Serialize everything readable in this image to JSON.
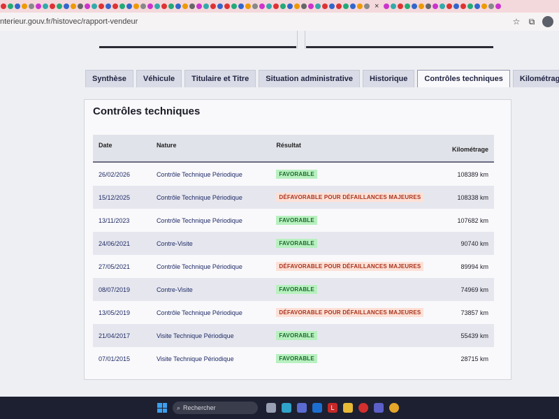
{
  "browser": {
    "url": "nterieur.gouv.fr/histovec/rapport-vendeur",
    "tab_close": "×"
  },
  "tabs": [
    {
      "label": "Synthèse",
      "active": false
    },
    {
      "label": "Véhicule",
      "active": false
    },
    {
      "label": "Titulaire et Titre",
      "active": false
    },
    {
      "label": "Situation administrative",
      "active": false
    },
    {
      "label": "Historique",
      "active": false
    },
    {
      "label": "Contrôles techniques",
      "active": true
    },
    {
      "label": "Kilométrage",
      "active": false
    }
  ],
  "section": {
    "title": "Contrôles techniques",
    "columns": [
      "Date",
      "Nature",
      "Résultat",
      "Kilométrage"
    ],
    "rows": [
      {
        "date": "26/02/2026",
        "nature": "Contrôle Technique Périodique",
        "result": "FAVORABLE",
        "status": "fav",
        "km": "108389 km"
      },
      {
        "date": "15/12/2025",
        "nature": "Contrôle Technique Périodique",
        "result": "DÉFAVORABLE POUR DÉFAILLANCES MAJEURES",
        "status": "defav",
        "km": "108338 km"
      },
      {
        "date": "13/11/2023",
        "nature": "Contrôle Technique Périodique",
        "result": "FAVORABLE",
        "status": "fav",
        "km": "107682 km"
      },
      {
        "date": "24/06/2021",
        "nature": "Contre-Visite",
        "result": "FAVORABLE",
        "status": "fav",
        "km": "90740 km"
      },
      {
        "date": "27/05/2021",
        "nature": "Contrôle Technique Périodique",
        "result": "DÉFAVORABLE POUR DÉFAILLANCES MAJEURES",
        "status": "defav",
        "km": "89994 km"
      },
      {
        "date": "08/07/2019",
        "nature": "Contre-Visite",
        "result": "FAVORABLE",
        "status": "fav",
        "km": "74969 km"
      },
      {
        "date": "13/05/2019",
        "nature": "Contrôle Technique Périodique",
        "result": "DÉFAVORABLE POUR DÉFAILLANCES MAJEURES",
        "status": "defav",
        "km": "73857 km"
      },
      {
        "date": "21/04/2017",
        "nature": "Visite Technique Périodique",
        "result": "FAVORABLE",
        "status": "fav",
        "km": "55439 km"
      },
      {
        "date": "07/01/2015",
        "nature": "Visite Technique Périodique",
        "result": "FAVORABLE",
        "status": "fav",
        "km": "28715 km"
      }
    ]
  },
  "taskbar": {
    "search_placeholder": "Rechercher",
    "colors": {
      "start": "#3aa0f0",
      "fav_bg": "#b8f0c0",
      "defav_bg": "#fde0d6"
    }
  }
}
